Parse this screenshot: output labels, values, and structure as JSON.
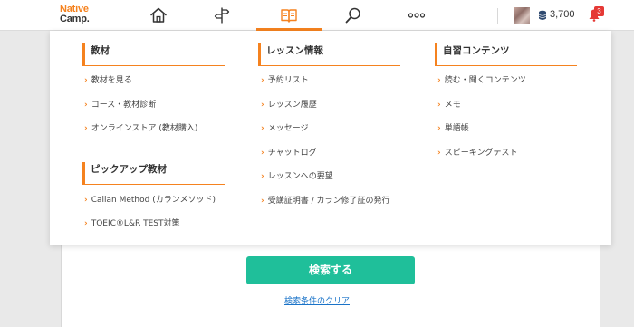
{
  "header": {
    "logo_line1": "Native",
    "logo_line2": "Camp.",
    "nav": [
      "home-icon",
      "signpost-icon",
      "book-icon",
      "search-icon",
      "more-icon"
    ],
    "active_nav": "book-icon",
    "points": "3,700",
    "notification_count": "3",
    "accent_color": "#f5821f"
  },
  "menu": {
    "materials": {
      "title": "教材",
      "links": [
        "教材を見る",
        "コース・教材診断",
        "オンラインストア (教材購入)"
      ]
    },
    "pickup": {
      "title": "ピックアップ教材",
      "links": [
        "Callan Method (カランメソッド)",
        "TOEIC®L&R TEST対策"
      ]
    },
    "lesson": {
      "title": "レッスン情報",
      "links": [
        "予約リスト",
        "レッスン履歴",
        "メッセージ",
        "チャットログ",
        "レッスンへの要望",
        "受講証明書 / カラン修了証の発行"
      ]
    },
    "self_study": {
      "title": "自習コンテンツ",
      "links": [
        "読む・聞くコンテンツ",
        "メモ",
        "単語帳",
        "スピーキングテスト"
      ]
    }
  },
  "page": {
    "search_button": "検索する",
    "clear_link": "検索条件のクリア",
    "button_color": "#1fbf9a"
  }
}
